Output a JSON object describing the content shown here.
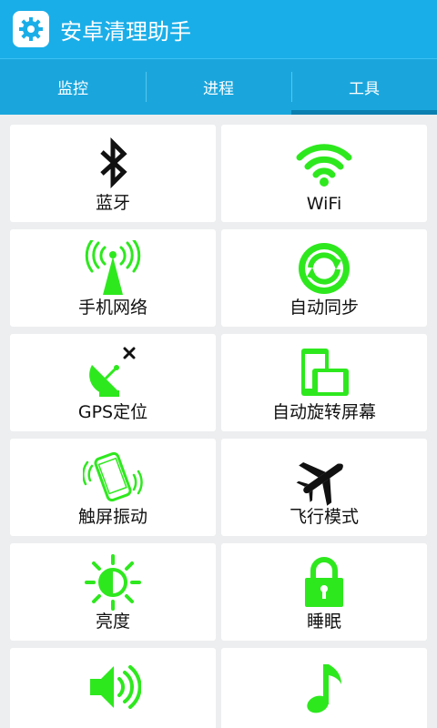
{
  "app": {
    "title": "安卓清理助手",
    "icon": "gear-icon"
  },
  "tabs": [
    {
      "label": "监控"
    },
    {
      "label": "进程"
    },
    {
      "label": "工具",
      "active": true
    }
  ],
  "colors": {
    "header": "#1aaee8",
    "accent": "#2ee81e",
    "icon_dark": "#111111"
  },
  "tools": [
    {
      "label": "蓝牙",
      "icon": "bluetooth-icon"
    },
    {
      "label": "WiFi",
      "icon": "wifi-icon"
    },
    {
      "label": "手机网络",
      "icon": "cell-tower-icon"
    },
    {
      "label": "自动同步",
      "icon": "sync-icon"
    },
    {
      "label": "GPS定位",
      "icon": "satellite-dish-icon"
    },
    {
      "label": "自动旋转屏幕",
      "icon": "screen-rotate-icon"
    },
    {
      "label": "触屏振动",
      "icon": "phone-vibrate-icon"
    },
    {
      "label": "飞行模式",
      "icon": "airplane-icon"
    },
    {
      "label": "亮度",
      "icon": "brightness-icon"
    },
    {
      "label": "睡眠",
      "icon": "lock-icon"
    },
    {
      "label": "",
      "icon": "volume-icon"
    },
    {
      "label": "",
      "icon": "music-note-icon"
    }
  ]
}
